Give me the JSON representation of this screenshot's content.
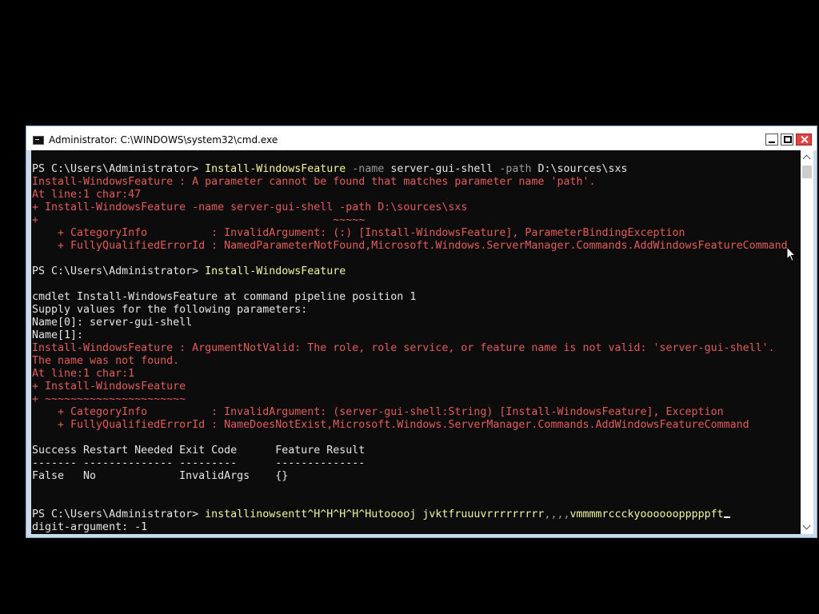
{
  "window": {
    "title": "Administrator: C:\\WINDOWS\\system32\\cmd.exe"
  },
  "console": {
    "lines": [
      [
        {
          "c": "w",
          "t": "PS C:\\Users\\Administrator> "
        },
        {
          "c": "y",
          "t": "Install-WindowsFeature "
        },
        {
          "c": "g",
          "t": "-name "
        },
        {
          "c": "w",
          "t": "server-gui-shell "
        },
        {
          "c": "g",
          "t": "-path "
        },
        {
          "c": "w",
          "t": "D:\\sources\\sxs"
        }
      ],
      [
        {
          "c": "r",
          "t": "Install-WindowsFeature : A parameter cannot be found that matches parameter name 'path'."
        }
      ],
      [
        {
          "c": "r",
          "t": "At line:1 char:47"
        }
      ],
      [
        {
          "c": "r",
          "t": "+ Install-WindowsFeature -name server-gui-shell -path D:\\sources\\sxs"
        }
      ],
      [
        {
          "c": "r",
          "t": "+                                              ~~~~~"
        }
      ],
      [
        {
          "c": "r",
          "t": "    + CategoryInfo          : InvalidArgument: (:) [Install-WindowsFeature], ParameterBindingException"
        }
      ],
      [
        {
          "c": "r",
          "t": "    + FullyQualifiedErrorId : NamedParameterNotFound,Microsoft.Windows.ServerManager.Commands.AddWindowsFeatureCommand"
        }
      ],
      [
        {
          "c": "w",
          "t": ""
        }
      ],
      [
        {
          "c": "w",
          "t": "PS C:\\Users\\Administrator> "
        },
        {
          "c": "y",
          "t": "Install-WindowsFeature"
        }
      ],
      [
        {
          "c": "w",
          "t": ""
        }
      ],
      [
        {
          "c": "w",
          "t": "cmdlet Install-WindowsFeature at command pipeline position 1"
        }
      ],
      [
        {
          "c": "w",
          "t": "Supply values for the following parameters:"
        }
      ],
      [
        {
          "c": "w",
          "t": "Name[0]: server-gui-shell"
        }
      ],
      [
        {
          "c": "w",
          "t": "Name[1]:"
        }
      ],
      [
        {
          "c": "r",
          "t": "Install-WindowsFeature : ArgumentNotValid: The role, role service, or feature name is not valid: 'server-gui-shell'."
        }
      ],
      [
        {
          "c": "r",
          "t": "The name was not found."
        }
      ],
      [
        {
          "c": "r",
          "t": "At line:1 char:1"
        }
      ],
      [
        {
          "c": "r",
          "t": "+ Install-WindowsFeature"
        }
      ],
      [
        {
          "c": "r",
          "t": "+ ~~~~~~~~~~~~~~~~~~~~~~"
        }
      ],
      [
        {
          "c": "r",
          "t": "    + CategoryInfo          : InvalidArgument: (server-gui-shell:String) [Install-WindowsFeature], Exception"
        }
      ],
      [
        {
          "c": "r",
          "t": "    + FullyQualifiedErrorId : NameDoesNotExist,Microsoft.Windows.ServerManager.Commands.AddWindowsFeatureCommand"
        }
      ],
      [
        {
          "c": "w",
          "t": ""
        }
      ],
      [
        {
          "c": "w",
          "t": "Success Restart Needed Exit Code      Feature Result"
        }
      ],
      [
        {
          "c": "w",
          "t": "------- -------------- ---------      --------------"
        }
      ],
      [
        {
          "c": "w",
          "t": "False   No             InvalidArgs    {}"
        }
      ],
      [
        {
          "c": "w",
          "t": ""
        }
      ],
      [
        {
          "c": "w",
          "t": ""
        }
      ],
      [
        {
          "c": "w",
          "t": "PS C:\\Users\\Administrator> "
        },
        {
          "c": "y",
          "t": "installinowsentt^H^H^H^H^Hutooooj jvktfruuuvrrrrrrrrr"
        },
        {
          "c": "g",
          "t": ",,,,"
        },
        {
          "c": "y",
          "t": "vmmmmrccckyoooooopppppft"
        }
      ],
      [
        {
          "c": "w",
          "t": "digit-argument: -1"
        }
      ]
    ]
  },
  "colors": {
    "console_bg": "#0c0c0c",
    "text_default": "#e6e6e6",
    "text_command": "#f4f4a0",
    "text_error": "#e35c5c",
    "text_param": "#9a9a9a",
    "close_button": "#e04343"
  }
}
